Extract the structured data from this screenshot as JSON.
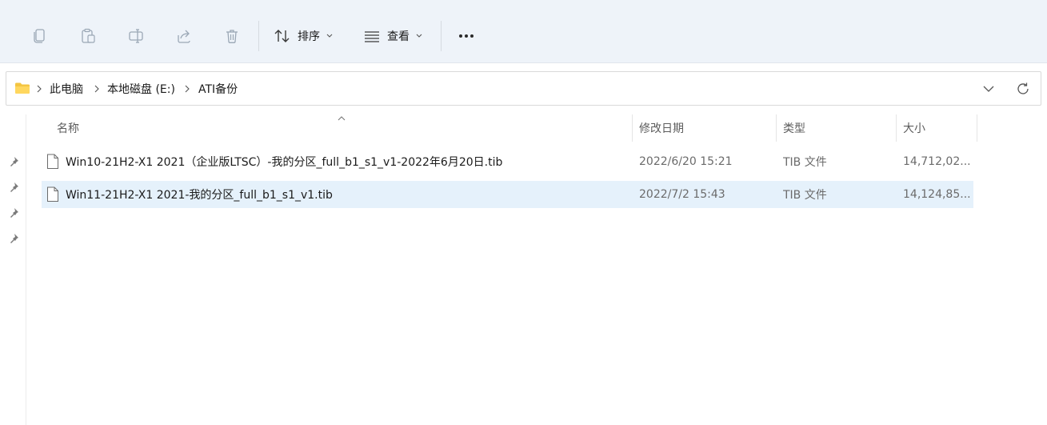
{
  "toolbar": {
    "buttons": [
      {
        "icon": "copy-icon"
      },
      {
        "icon": "paste-icon"
      },
      {
        "icon": "rename-icon"
      },
      {
        "icon": "share-icon"
      },
      {
        "icon": "delete-icon"
      }
    ],
    "sort_label": "排序",
    "view_label": "查看",
    "more_icon": "more-options-icon"
  },
  "address": {
    "folder_icon": "folder-icon",
    "crumbs": [
      "此电脑",
      "本地磁盘 (E:)",
      "ATI备份"
    ]
  },
  "columns": {
    "name": "名称",
    "modified": "修改日期",
    "type": "类型",
    "size": "大小"
  },
  "files": [
    {
      "name": "Win10-21H2-X1 2021（企业版LTSC）-我的分区_full_b1_s1_v1-2022年6月20日.tib",
      "modified": "2022/6/20 15:21",
      "type": "TIB 文件",
      "size": "14,712,02..."
    },
    {
      "name": "Win11-21H2-X1 2021-我的分区_full_b1_s1_v1.tib",
      "modified": "2022/7/2 15:43",
      "type": "TIB 文件",
      "size": "14,124,85..."
    }
  ],
  "colors": {
    "toolbar_bg": "#eef3f9",
    "selected_row": "#e5f1fb",
    "folder": "#f4c542"
  }
}
